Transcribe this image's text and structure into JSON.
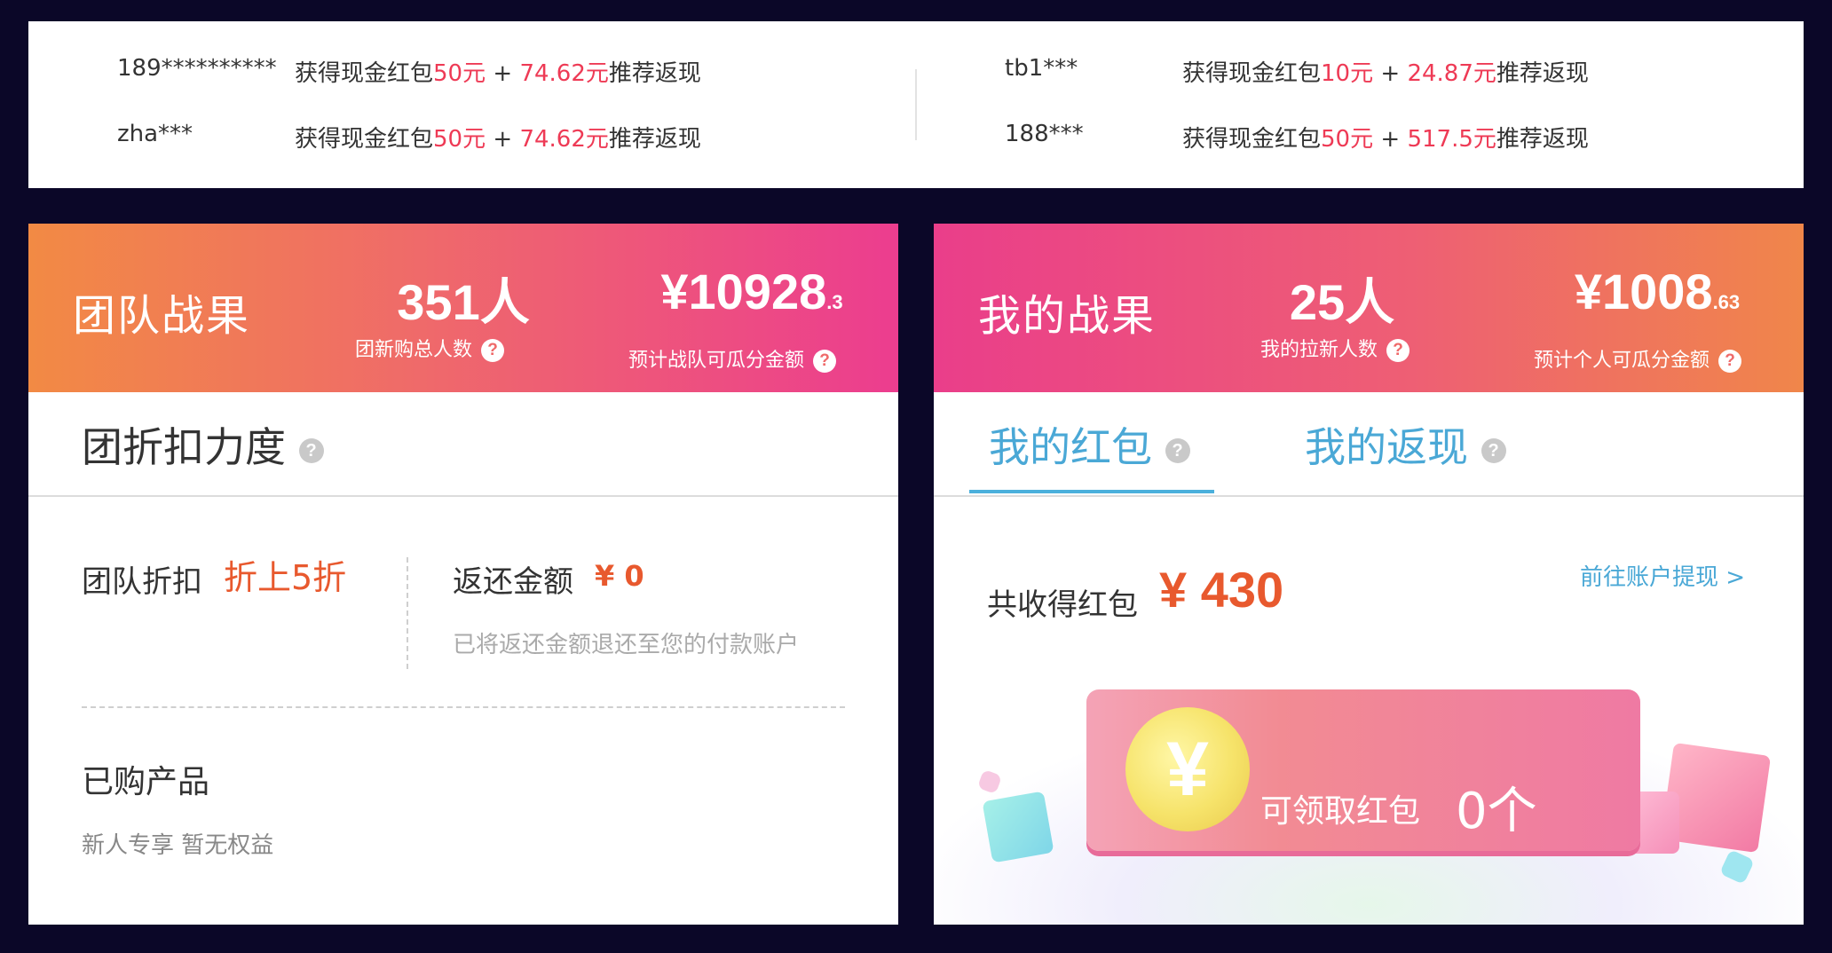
{
  "ticker": {
    "left": [
      {
        "user": "189**********",
        "text": "获得现金红包",
        "amount": "50元",
        "plus": "+",
        "bonus": "74.62元",
        "suffix": "推荐返现"
      },
      {
        "user": "zha***",
        "text": "获得现金红包",
        "amount": "50元",
        "plus": "+",
        "bonus": "74.62元",
        "suffix": "推荐返现"
      }
    ],
    "right": [
      {
        "user": "tb1***",
        "text": "获得现金红包",
        "amount": "10元",
        "plus": "+",
        "bonus": "24.87元",
        "suffix": "推荐返现"
      },
      {
        "user": "188***",
        "text": "获得现金红包",
        "amount": "50元",
        "plus": "+",
        "bonus": "517.5元",
        "suffix": "推荐返现"
      }
    ]
  },
  "team": {
    "title": "团队战果",
    "count": "351人",
    "count_label": "团新购总人数",
    "amount_main": "¥10928",
    "amount_dec": ".3",
    "amount_label": "预计战队可瓜分金额",
    "discount_title": "团折扣力度",
    "discount_label": "团队折扣",
    "discount_value": "折上5折",
    "refund_label": "返还金额",
    "refund_value": "¥ 0",
    "refund_note": "已将返还金额退还至您的付款账户",
    "bought_title": "已购产品",
    "bought_note": "新人专享 暂无权益"
  },
  "mine": {
    "title": "我的战果",
    "count": "25人",
    "count_label": "我的拉新人数",
    "amount_main": "¥1008",
    "amount_dec": ".63",
    "amount_label": "预计个人可瓜分金额",
    "tabs": [
      {
        "label": "我的红包"
      },
      {
        "label": "我的返现"
      }
    ],
    "total_label": "共收得红包",
    "total_value": "¥ 430",
    "withdraw_link": "前往账户提现 >",
    "card_label": "可领取红包",
    "card_count": "0个"
  },
  "icons": {
    "help": "question-circle-icon",
    "coin": "yuan-coin-icon"
  },
  "colors": {
    "accent_red": "#ee3a55",
    "accent_orange": "#e8592e",
    "tab_blue": "#4aa8d6"
  }
}
